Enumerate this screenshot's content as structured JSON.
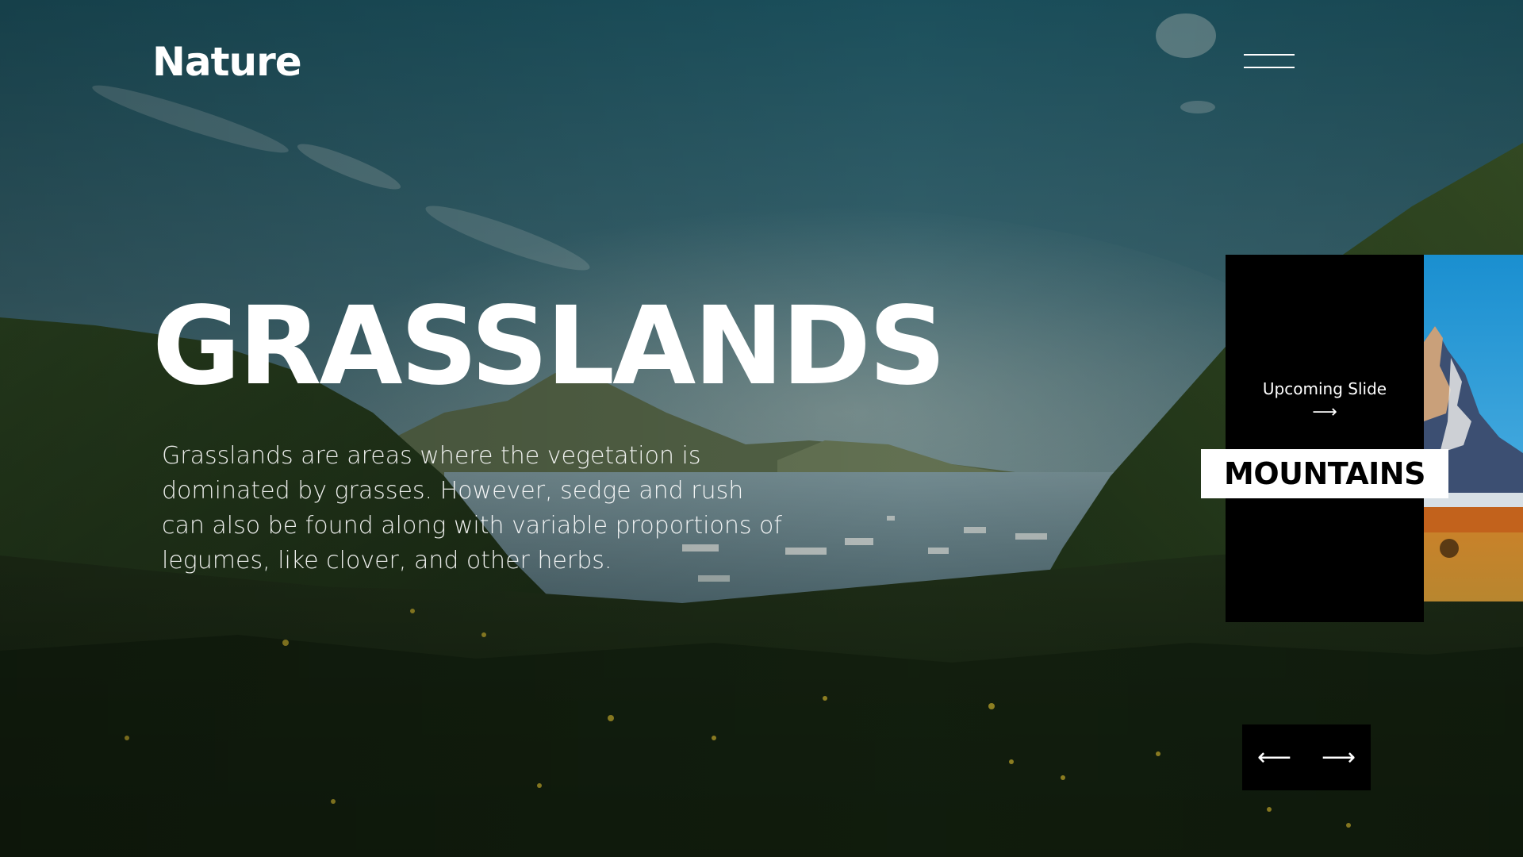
{
  "header": {
    "logo": "Nature",
    "menu_icon": "hamburger-menu-icon"
  },
  "hero": {
    "title": "GRASSLANDS",
    "description": "Grasslands are areas where the vegetation is dominated by grasses. However, sedge and rush can also be found along with variable proportions of legumes, like clover, and other herbs."
  },
  "next_slide": {
    "caption": "Upcoming Slide",
    "arrow_icon": "arrow-right-icon",
    "arrow_glyph": "⟶",
    "title": "MOUNTAINS"
  },
  "controls": {
    "prev_icon": "arrow-left-icon",
    "prev_glyph": "⟵",
    "next_icon": "arrow-right-icon",
    "next_glyph": "⟶"
  },
  "colors": {
    "card_bg": "#000000",
    "label_bg": "#ffffff",
    "text": "#ffffff"
  }
}
